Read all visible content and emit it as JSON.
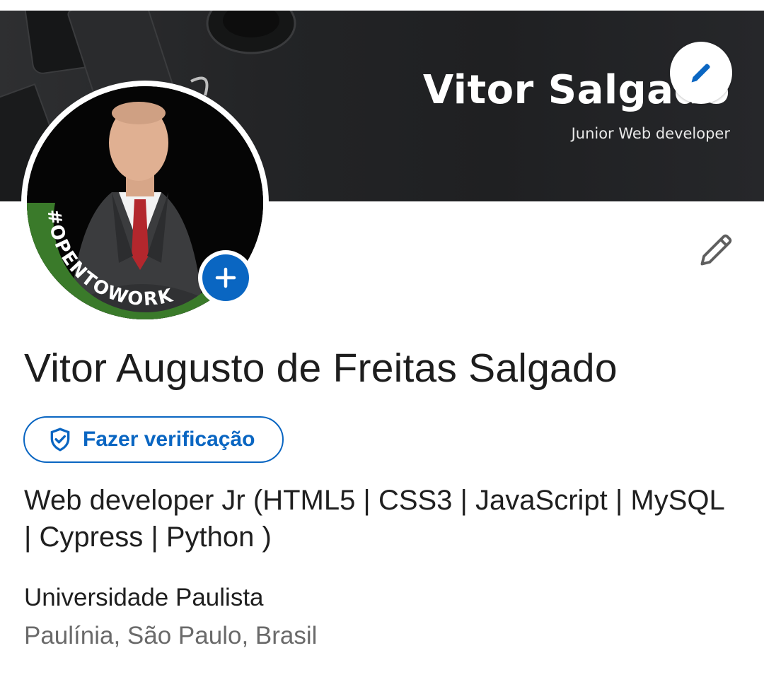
{
  "cover": {
    "title": "Vitor Salgado",
    "subtitle": "Junior Web developer",
    "edit_icon": "pencil-icon"
  },
  "avatar": {
    "frame_text": "#OPENTOWORK",
    "frame_color": "#3a7a2a",
    "add_icon": "plus-icon"
  },
  "profile": {
    "edit_icon": "pencil-icon",
    "name": "Vitor Augusto de Freitas Salgado",
    "verify_label": "Fazer verificação",
    "verify_icon": "shield-check-icon",
    "headline": "Web developer Jr (HTML5 | CSS3 | JavaScript | MySQL | Cypress | Python )",
    "school": "Universidade Paulista",
    "location": "Paulínia, São Paulo, Brasil"
  },
  "colors": {
    "accent": "#0a66c2",
    "cover_bg": "#232426",
    "text_primary": "#1f1f1f",
    "text_secondary": "#6a6a6a"
  }
}
